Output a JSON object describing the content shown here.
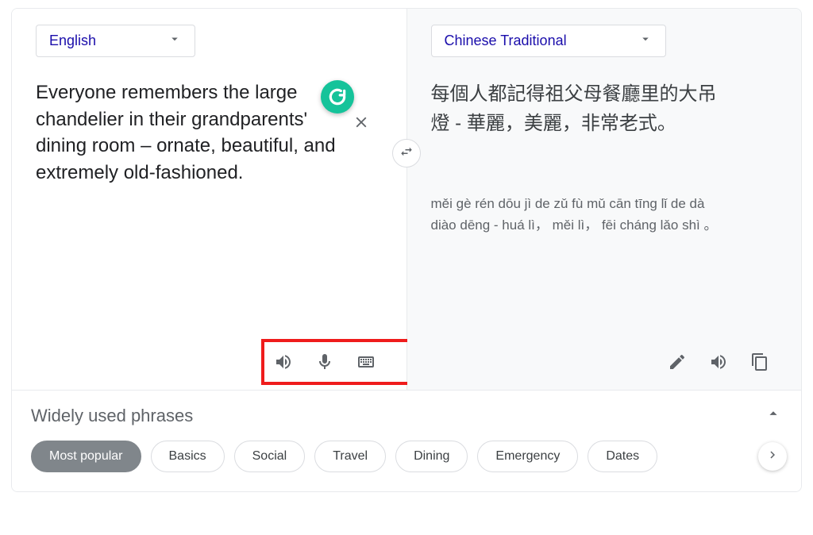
{
  "source": {
    "language": "English",
    "text": "Everyone remembers the large chandelier in their grandparents' dining room – ornate, beautiful, and extremely old-fashioned."
  },
  "target": {
    "language": "Chinese Traditional",
    "text": "每個人都記得祖父母餐廳里的大吊燈 - 華麗，美麗，非常老式。",
    "romanization": "měi gè rén dōu jì de zǔ fù mǔ cān tīng lǐ de dà diào dēng - huá lì， měi lì， fēi cháng lǎo shì 。"
  },
  "phrases": {
    "title": "Widely used phrases",
    "categories": [
      "Most popular",
      "Basics",
      "Social",
      "Travel",
      "Dining",
      "Emergency",
      "Dates"
    ],
    "active_index": 0
  }
}
